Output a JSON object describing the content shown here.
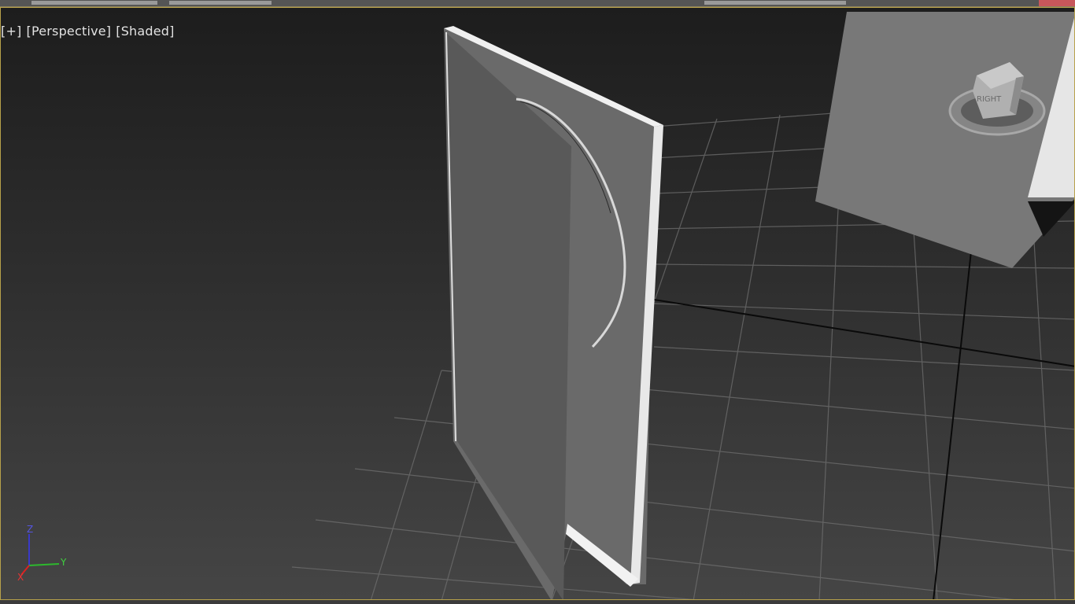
{
  "window": {
    "accent_color": "#b7a14a",
    "close_accent_color": "#c8575b"
  },
  "viewport": {
    "label_plus": "[+]",
    "label_view": "[Perspective]",
    "label_mode": "[Shaded]"
  },
  "viewcube": {
    "face_label": "RIGHT",
    "icon": "viewcube-icon"
  },
  "axis_tripod": {
    "z_label": "Z",
    "y_label": "Y",
    "x_label": "X",
    "icon": "axis-tripod-icon"
  },
  "scene": {
    "objects": [
      "door-panel",
      "background-plane"
    ]
  }
}
